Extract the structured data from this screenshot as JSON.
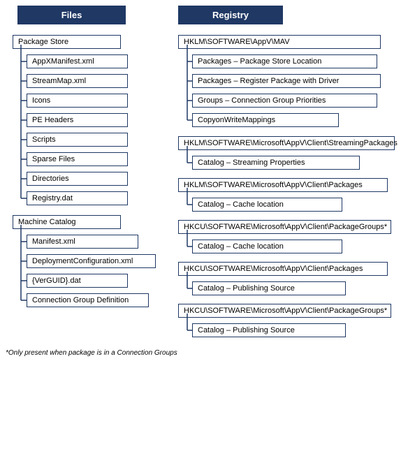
{
  "headers": {
    "files": "Files",
    "registry": "Registry"
  },
  "left": {
    "packageStore": "Package Store",
    "children_left": [
      "AppXManifest.xml",
      "StreamMap.xml",
      "Icons",
      "PE Headers",
      "Scripts",
      "Sparse Files",
      "Directories",
      "Registry.dat"
    ],
    "machineCatalog": "Machine Catalog",
    "children_mc": [
      "Manifest.xml",
      "DeploymentConfiguration.xml",
      "{VerGUID}.dat",
      "Connection Group Definition"
    ]
  },
  "right": {
    "rows": [
      {
        "type": "reg",
        "text": "HKLM\\SOFTWARE\\AppV\\MAV"
      },
      {
        "type": "sub",
        "text": "Packages – Package Store Location"
      },
      {
        "type": "sub",
        "text": "Packages – Register Package with Driver"
      },
      {
        "type": "sub",
        "text": "Groups – Connection Group Priorities"
      },
      {
        "type": "sub",
        "text": "CopyonWriteMappings"
      },
      {
        "type": "reg",
        "text": "HKLM\\SOFTWARE\\Microsoft\\AppV\\Client\\StreamingPackages"
      },
      {
        "type": "sub",
        "text": "Catalog – Streaming Properties"
      },
      {
        "type": "reg",
        "text": "HKLM\\SOFTWARE\\Microsoft\\AppV\\Client\\Packages"
      },
      {
        "type": "sub",
        "text": "Catalog – Cache location"
      },
      {
        "type": "reg",
        "text": "HKCU\\SOFTWARE\\Microsoft\\AppV\\Client\\PackageGroups*"
      },
      {
        "type": "sub",
        "text": "Catalog – Cache location"
      },
      {
        "type": "reg",
        "text": "HKCU\\SOFTWARE\\Microsoft\\AppV\\Client\\Packages"
      },
      {
        "type": "sub",
        "text": "Catalog – Publishing Source"
      },
      {
        "type": "reg",
        "text": "HKCU\\SOFTWARE\\Microsoft\\AppV\\Client\\PackageGroups*"
      },
      {
        "type": "sub",
        "text": "Catalog – Publishing Source"
      }
    ]
  },
  "footnote": "*Only present when package is in a Connection Groups"
}
